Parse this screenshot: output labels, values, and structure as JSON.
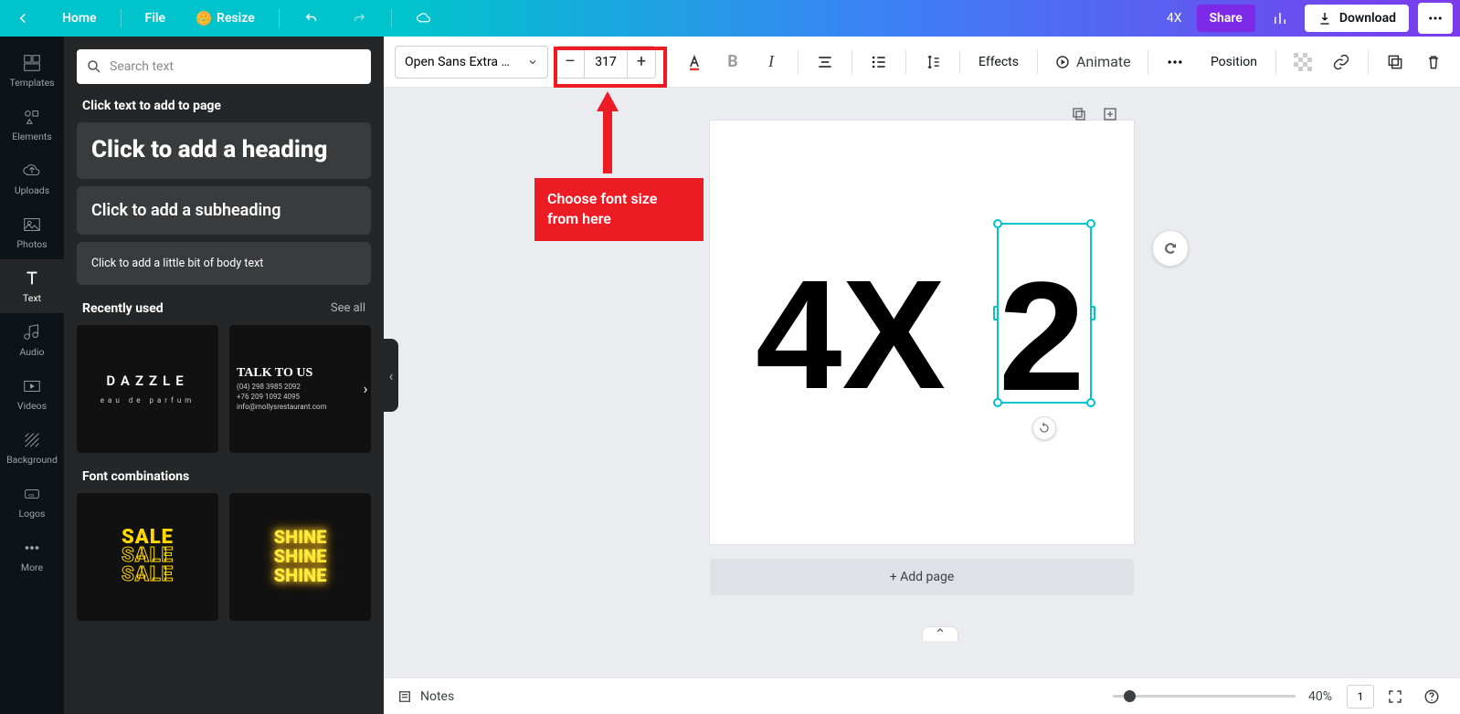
{
  "header": {
    "home": "Home",
    "file": "File",
    "resize": "Resize",
    "doc_title": "4X",
    "share": "Share",
    "download": "Download"
  },
  "rail": [
    {
      "label": "Templates"
    },
    {
      "label": "Elements"
    },
    {
      "label": "Uploads"
    },
    {
      "label": "Photos"
    },
    {
      "label": "Text"
    },
    {
      "label": "Audio"
    },
    {
      "label": "Videos"
    },
    {
      "label": "Background"
    },
    {
      "label": "Logos"
    },
    {
      "label": "More"
    }
  ],
  "panel": {
    "search_placeholder": "Search text",
    "click_to_add": "Click text to add to page",
    "heading_card": "Click to add a heading",
    "subheading_card": "Click to add a subheading",
    "body_card": "Click to add a little bit of body text",
    "recent_title": "Recently used",
    "see_all": "See all",
    "font_combo_title": "Font combinations",
    "thumb1_title": "DAZZLE",
    "thumb1_sub": "eau de parfum",
    "thumb2_title": "TALK TO US",
    "thumb2_l1": "(04) 298 3985 2092",
    "thumb2_l2": "+76 209 1092 4095",
    "thumb2_l3": "info@mollysrestaurant.com",
    "sale": "SALE",
    "shine": "SHINE"
  },
  "toolbar": {
    "font_name": "Open Sans Extra …",
    "font_size": "317",
    "effects": "Effects",
    "animate": "Animate",
    "position": "Position"
  },
  "canvas": {
    "text_4x": "4X",
    "text_2": "2",
    "add_page": "+ Add page"
  },
  "bottom": {
    "notes": "Notes",
    "zoom_label": "40%",
    "page_count": "1"
  },
  "annotation": {
    "callout": "Choose font size from here"
  }
}
